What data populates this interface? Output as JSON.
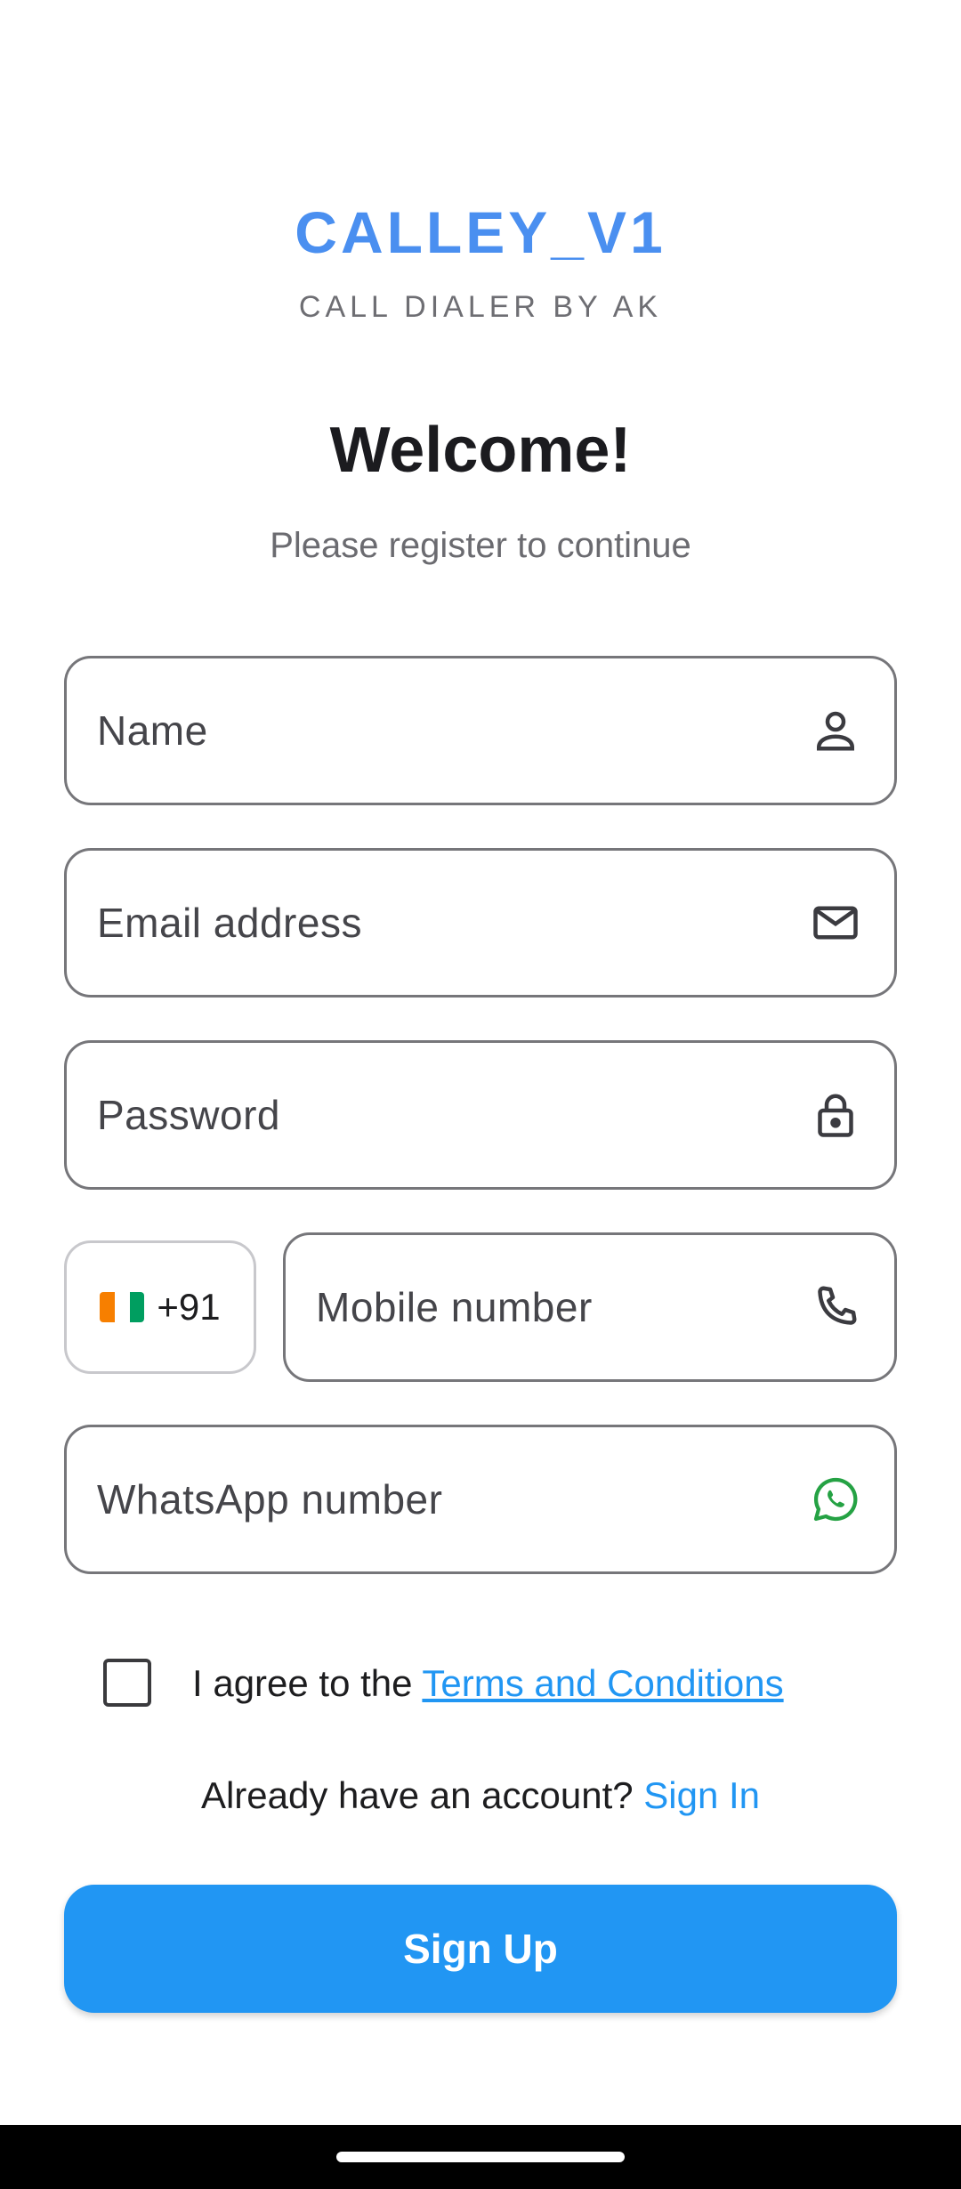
{
  "brand": {
    "title": "CALLEY_V1",
    "subtitle": "CALL DIALER BY AK"
  },
  "heading": {
    "title": "Welcome!",
    "subtitle": "Please register to continue"
  },
  "form": {
    "name_label": "Name",
    "name_icon": "person-icon",
    "email_label": "Email address",
    "email_icon": "mail-icon",
    "password_label": "Password",
    "password_icon": "lock-icon",
    "country_code": "+91",
    "country_flag": "flag-icon",
    "mobile_label": "Mobile number",
    "mobile_icon": "phone-icon",
    "whatsapp_label": "WhatsApp number",
    "whatsapp_icon": "whatsapp-icon"
  },
  "terms": {
    "checked": false,
    "prefix": "I agree to the ",
    "link": "Terms and Conditions"
  },
  "account": {
    "prompt": "Already have an account? ",
    "link": "Sign In"
  },
  "actions": {
    "signup_label": "Sign Up"
  },
  "colors": {
    "brand": "#4a8ff0",
    "primary": "#2196f3",
    "whatsapp": "#25a244",
    "flag_orange": "#f77f00",
    "flag_white": "#ffffff",
    "flag_green": "#009e60"
  }
}
